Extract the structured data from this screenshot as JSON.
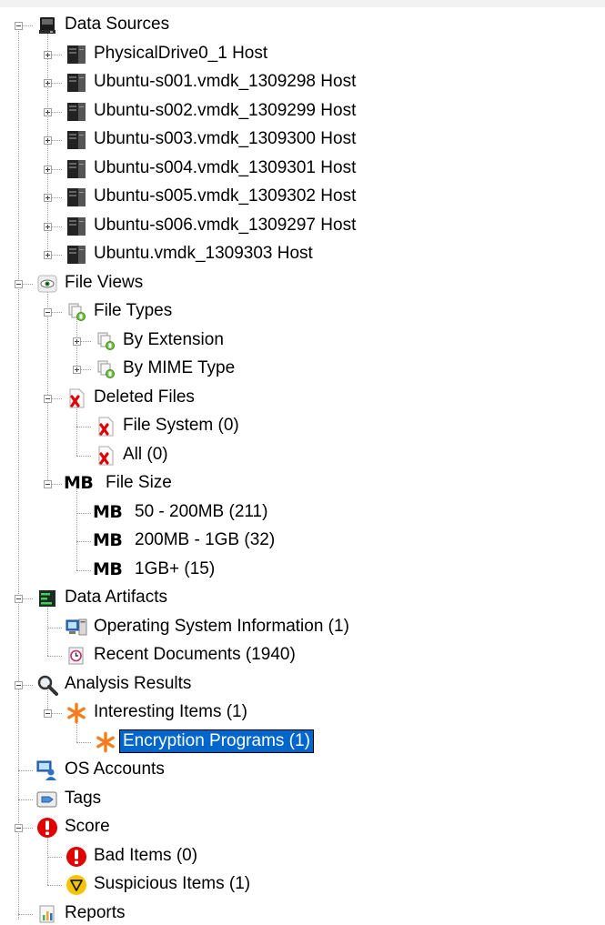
{
  "tree": {
    "selected": "Encryption Programs (1)",
    "nodes": [
      {
        "label": "Data Sources",
        "depth": 0,
        "state": "open",
        "icon": "hard-disk-icon",
        "name": "data-sources"
      },
      {
        "label": "PhysicalDrive0_1 Host",
        "depth": 1,
        "state": "closed",
        "icon": "host-server-icon",
        "name": "physicaldrive0-1-host"
      },
      {
        "label": "Ubuntu-s001.vmdk_1309298 Host",
        "depth": 1,
        "state": "closed",
        "icon": "host-server-icon",
        "name": "ubuntu-s001-host"
      },
      {
        "label": "Ubuntu-s002.vmdk_1309299 Host",
        "depth": 1,
        "state": "closed",
        "icon": "host-server-icon",
        "name": "ubuntu-s002-host"
      },
      {
        "label": "Ubuntu-s003.vmdk_1309300 Host",
        "depth": 1,
        "state": "closed",
        "icon": "host-server-icon",
        "name": "ubuntu-s003-host"
      },
      {
        "label": "Ubuntu-s004.vmdk_1309301 Host",
        "depth": 1,
        "state": "closed",
        "icon": "host-server-icon",
        "name": "ubuntu-s004-host"
      },
      {
        "label": "Ubuntu-s005.vmdk_1309302 Host",
        "depth": 1,
        "state": "closed",
        "icon": "host-server-icon",
        "name": "ubuntu-s005-host"
      },
      {
        "label": "Ubuntu-s006.vmdk_1309297 Host",
        "depth": 1,
        "state": "closed",
        "icon": "host-server-icon",
        "name": "ubuntu-s006-host"
      },
      {
        "label": "Ubuntu.vmdk_1309303 Host",
        "depth": 1,
        "state": "closed",
        "icon": "host-server-icon",
        "name": "ubuntu-vmdk-host"
      },
      {
        "label": "File Views",
        "depth": 0,
        "state": "open",
        "icon": "eye-icon",
        "name": "file-views"
      },
      {
        "label": "File Types",
        "depth": 1,
        "state": "open",
        "icon": "file-types-icon",
        "name": "file-types"
      },
      {
        "label": "By Extension",
        "depth": 2,
        "state": "closed",
        "icon": "file-types-icon",
        "name": "by-extension"
      },
      {
        "label": "By MIME Type",
        "depth": 2,
        "state": "closed",
        "icon": "file-types-icon",
        "name": "by-mime-type"
      },
      {
        "label": "Deleted Files",
        "depth": 1,
        "state": "open",
        "icon": "deleted-file-icon",
        "name": "deleted-files"
      },
      {
        "label": "File System (0)",
        "depth": 2,
        "state": "leaf",
        "icon": "deleted-file-icon",
        "name": "deleted-file-system"
      },
      {
        "label": "All (0)",
        "depth": 2,
        "state": "leaf",
        "icon": "deleted-file-icon",
        "name": "deleted-all"
      },
      {
        "label": "File Size",
        "depth": 1,
        "state": "open",
        "icon": "mb-icon",
        "name": "file-size"
      },
      {
        "label": "50 - 200MB (211)",
        "depth": 2,
        "state": "leaf",
        "icon": "mb-icon",
        "name": "size-50-200mb"
      },
      {
        "label": "200MB - 1GB (32)",
        "depth": 2,
        "state": "leaf",
        "icon": "mb-icon",
        "name": "size-200mb-1gb"
      },
      {
        "label": "1GB+ (15)",
        "depth": 2,
        "state": "leaf",
        "icon": "mb-icon",
        "name": "size-1gb-plus"
      },
      {
        "label": "Data Artifacts",
        "depth": 0,
        "state": "open",
        "icon": "data-artifacts-icon",
        "name": "data-artifacts"
      },
      {
        "label": "Operating System Information (1)",
        "depth": 1,
        "state": "leaf",
        "icon": "computer-icon",
        "name": "os-information"
      },
      {
        "label": "Recent Documents (1940)",
        "depth": 1,
        "state": "leaf",
        "icon": "recent-document-icon",
        "name": "recent-documents"
      },
      {
        "label": "Analysis Results",
        "depth": 0,
        "state": "open",
        "icon": "magnifier-icon",
        "name": "analysis-results"
      },
      {
        "label": "Interesting Items (1)",
        "depth": 1,
        "state": "open",
        "icon": "asterisk-icon",
        "name": "interesting-items"
      },
      {
        "label": "Encryption Programs (1)",
        "depth": 2,
        "state": "leaf",
        "icon": "asterisk-icon",
        "name": "encryption-programs"
      },
      {
        "label": "OS Accounts",
        "depth": 0,
        "state": "leaf",
        "icon": "user-account-icon",
        "name": "os-accounts"
      },
      {
        "label": "Tags",
        "depth": 0,
        "state": "leaf",
        "icon": "tag-icon",
        "name": "tags"
      },
      {
        "label": "Score",
        "depth": 0,
        "state": "open",
        "icon": "exclamation-icon",
        "name": "score"
      },
      {
        "label": "Bad Items (0)",
        "depth": 1,
        "state": "leaf",
        "icon": "exclamation-icon",
        "name": "bad-items"
      },
      {
        "label": "Suspicious Items (1)",
        "depth": 1,
        "state": "leaf",
        "icon": "warning-triangle-icon",
        "name": "suspicious-items"
      },
      {
        "label": "Reports",
        "depth": 0,
        "state": "leaf",
        "icon": "report-icon",
        "name": "reports"
      }
    ]
  },
  "icon_text": {
    "mb": "MB"
  },
  "colors": {
    "selection": "#0066cc",
    "asterisk": "#f57c1f",
    "bad": "#e00000",
    "suspicious": "#f5c400"
  }
}
